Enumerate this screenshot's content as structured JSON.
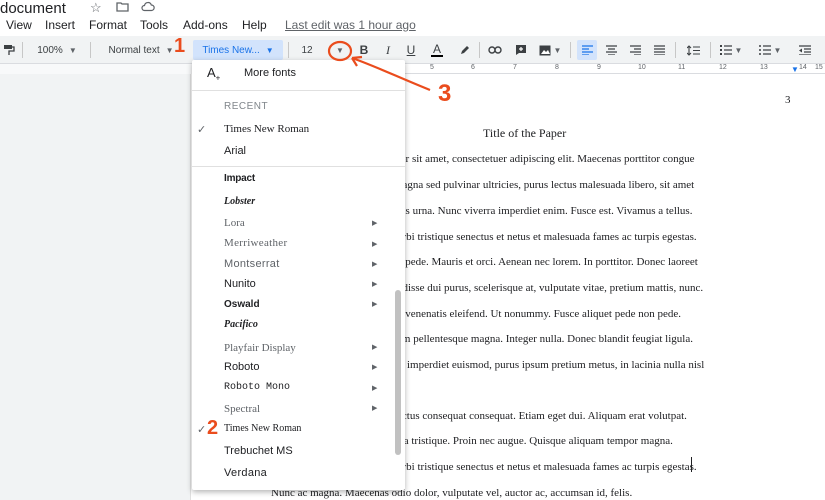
{
  "title_bar": {
    "doc_title": "document",
    "icons": [
      "star-icon",
      "move-to-folder-icon",
      "cloud-status-icon"
    ]
  },
  "menu": {
    "items": [
      "View",
      "Insert",
      "Format",
      "Tools",
      "Add-ons",
      "Help"
    ],
    "last_edit": "Last edit was 1 hour ago"
  },
  "toolbar": {
    "zoom": "100%",
    "style": "Normal text",
    "font": "Times New...",
    "font_size": "12",
    "buttons": [
      "bold-icon",
      "italic-icon",
      "underline-icon",
      "text-color-icon",
      "highlight-icon",
      "link-icon",
      "comment-icon",
      "image-icon",
      "align-left-icon",
      "align-center-icon",
      "align-right-icon",
      "justify-icon",
      "line-spacing-icon",
      "numbered-list-icon",
      "bulleted-list-icon"
    ]
  },
  "ruler": {
    "marks": [
      "5",
      "6",
      "7",
      "8",
      "9",
      "10",
      "11",
      "12",
      "13",
      "14",
      "15"
    ]
  },
  "font_menu": {
    "more_fonts": "More fonts",
    "recent_header": "RECENT",
    "recent": [
      {
        "name": "Times New Roman",
        "checked": true
      },
      {
        "name": "Arial",
        "checked": false
      }
    ],
    "fonts": [
      {
        "name": "Impact",
        "submenu": false,
        "checked": false
      },
      {
        "name": "Lobster",
        "submenu": false,
        "checked": false
      },
      {
        "name": "Lora",
        "submenu": true,
        "checked": false
      },
      {
        "name": "Merriweather",
        "submenu": true,
        "checked": false
      },
      {
        "name": "Montserrat",
        "submenu": true,
        "checked": false
      },
      {
        "name": "Nunito",
        "submenu": true,
        "checked": false
      },
      {
        "name": "Oswald",
        "submenu": true,
        "checked": false
      },
      {
        "name": "Pacifico",
        "submenu": false,
        "checked": false
      },
      {
        "name": "Playfair Display",
        "submenu": true,
        "checked": false
      },
      {
        "name": "Roboto",
        "submenu": true,
        "checked": false
      },
      {
        "name": "Roboto Mono",
        "submenu": true,
        "checked": false
      },
      {
        "name": "Spectral",
        "submenu": true,
        "checked": false
      },
      {
        "name": "Times New Roman",
        "submenu": false,
        "checked": true
      },
      {
        "name": "Trebuchet MS",
        "submenu": false,
        "checked": false
      },
      {
        "name": "Verdana",
        "submenu": false,
        "checked": false
      }
    ]
  },
  "document": {
    "page_number": "3",
    "title": "Title of the Paper",
    "lines": [
      "lor sit amet, consectetuer adipiscing elit. Maecenas porttitor congue",
      "nagna sed pulvinar ultricies, purus lectus malesuada libero, sit amet",
      "uis urna. Nunc viverra imperdiet enim. Fusce est. Vivamus a tellus.",
      "orbi tristique senectus et netus et malesuada fames ac turpis egestas.",
      "v pede. Mauris et orci. Aenean nec lorem. In porttitor. Donec laoreet",
      "ndisse dui purus, scelerisque at, vulputate vitae, pretium mattis, nunc.",
      "n venenatis eleifend. Ut nonummy. Fusce aliquet pede non pede.",
      "em pellentesque magna. Integer nulla. Donec blandit feugiat ligula.",
      "imperdiet euismod, purus ipsum pretium metus, in lacinia nulla nisl",
      "ectus consequat consequat. Etiam eget dui. Aliquam erat volutpat.",
      "rta tristique. Proin nec augue. Quisque aliquam tempor magna.",
      "orbi tristique senectus et netus et malesuada fames ac turpis egestas.",
      "Nunc ac magna. Maecenas odio dolor, vulputate vel, auctor ac, accumsan id, felis."
    ]
  },
  "annotations": {
    "labels": [
      "1",
      "2",
      "3"
    ],
    "color": "#ea4c1d"
  },
  "colors": {
    "accent": "#1a73e8",
    "selected_bg": "#d2e3fc",
    "toolbar_bg": "#f1f3f4"
  }
}
